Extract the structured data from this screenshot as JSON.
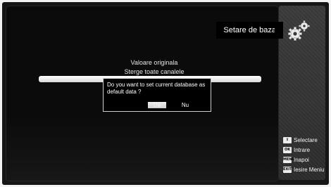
{
  "header": {
    "title": "Setare de baza"
  },
  "menu": {
    "items": [
      {
        "label": "Valoare originala"
      },
      {
        "label": "Sterge toate canalele"
      }
    ]
  },
  "dialog": {
    "message": "Do you want to set current database as default data ?",
    "yes_label": "Da",
    "no_label": "Nu",
    "selected": "Da"
  },
  "legend": [
    {
      "key": "⇕",
      "label": "Selectare",
      "icon": "up-down-key-icon"
    },
    {
      "key": "OK",
      "label": "Intrare",
      "icon": "ok-key-icon"
    },
    {
      "key": "MENU",
      "label": "Inapoi",
      "icon": "menu-key-icon"
    },
    {
      "key": "EXIT",
      "label": "Iesire Meniu",
      "icon": "exit-key-icon"
    }
  ],
  "icons": {
    "settings": "gears-icon"
  },
  "colors": {
    "background": "#0b0b0b",
    "side_panel": "#333333",
    "highlight": "#ffffff",
    "text": "#ffffff"
  }
}
